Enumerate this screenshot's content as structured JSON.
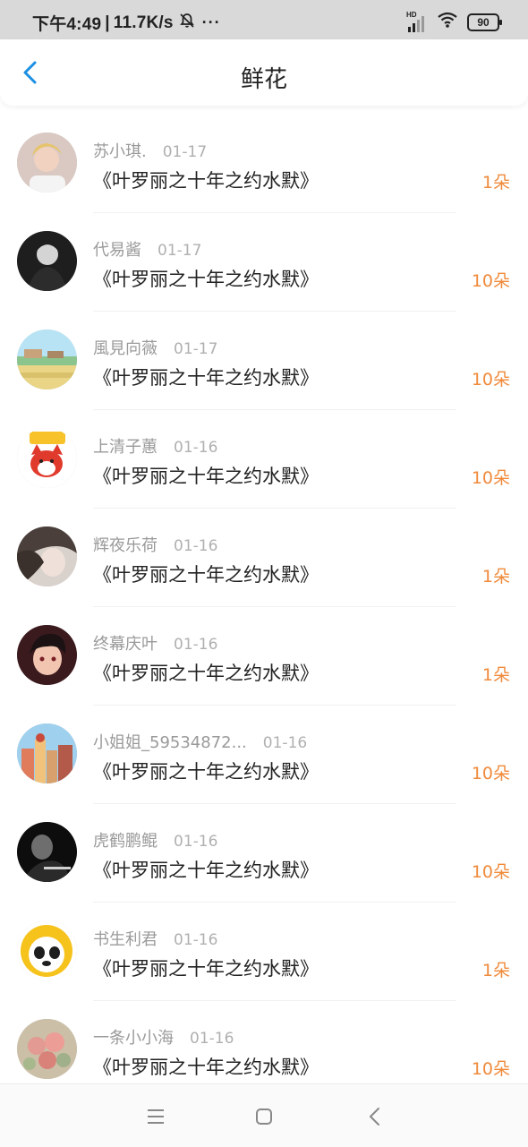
{
  "status_bar": {
    "time": "下午4:49",
    "separator": "|",
    "network_speed": "11.7K/s",
    "more": "···",
    "hd": "HD",
    "battery": "90"
  },
  "header": {
    "title": "鲜花",
    "back_icon": "chevron-left-icon",
    "accent_color": "#1a8fe3"
  },
  "count_color": "#f08a3b",
  "items": [
    {
      "name": "苏小琪.",
      "date": "01-17",
      "book": "《叶罗丽之十年之约水默》",
      "count": "1朵",
      "avatar": "doll-portrait"
    },
    {
      "name": "代易酱",
      "date": "01-17",
      "book": "《叶罗丽之十年之约水默》",
      "count": "10朵",
      "avatar": "bw-portrait"
    },
    {
      "name": "風見向薇",
      "date": "01-17",
      "book": "《叶罗丽之十年之约水默》",
      "count": "10朵",
      "avatar": "landscape"
    },
    {
      "name": "上清子蕙",
      "date": "01-16",
      "book": "《叶罗丽之十年之约水默》",
      "count": "10朵",
      "avatar": "cartoon-fox"
    },
    {
      "name": "辉夜乐荷",
      "date": "01-16",
      "book": "《叶罗丽之十年之约水默》",
      "count": "1朵",
      "avatar": "girl-portrait"
    },
    {
      "name": "终幕庆叶",
      "date": "01-16",
      "book": "《叶罗丽之十年之约水默》",
      "count": "1朵",
      "avatar": "anime-boy"
    },
    {
      "name": "小姐姐_59534872...",
      "date": "01-16",
      "book": "《叶罗丽之十年之约水默》",
      "count": "10朵",
      "avatar": "city-buildings"
    },
    {
      "name": "虎鹤鹏鲲",
      "date": "01-16",
      "book": "《叶罗丽之十年之约水默》",
      "count": "10朵",
      "avatar": "dark-portrait"
    },
    {
      "name": "书生利君",
      "date": "01-16",
      "book": "《叶罗丽之十年之约水默》",
      "count": "1朵",
      "avatar": "panda-lion"
    },
    {
      "name": "一条小小海",
      "date": "01-16",
      "book": "《叶罗丽之十年之约水默》",
      "count": "10朵",
      "avatar": "flowers"
    }
  ],
  "bottom_nav": {
    "menu_icon": "menu-icon",
    "home_icon": "home-square-icon",
    "back_icon": "back-triangle-icon"
  }
}
